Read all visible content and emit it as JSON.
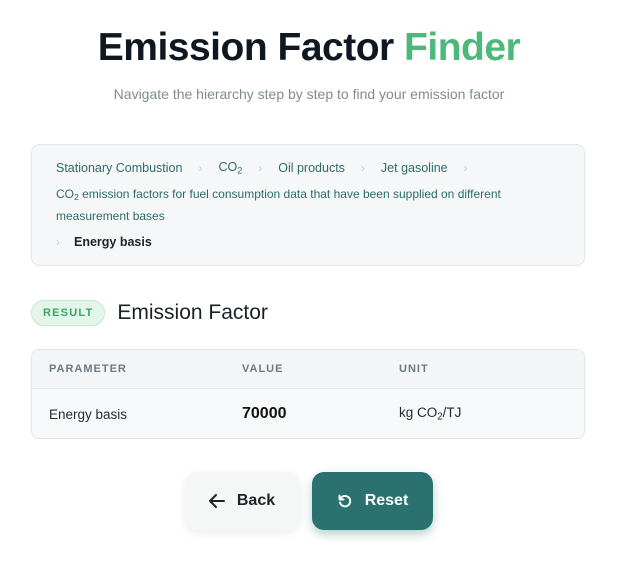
{
  "header": {
    "title_main": "Emission Factor",
    "title_accent": "Finder",
    "subtitle": "Navigate the hierarchy step by step to find your emission factor"
  },
  "breadcrumb": {
    "item1": "Stationary Combustion",
    "item2_prefix": "CO",
    "item2_sub": "2",
    "item3": "Oil products",
    "item4": "Jet gasoline",
    "item5_prefix": "CO",
    "item5_sub": "2",
    "item5_rest": " emission factors for fuel consumption data that have been supplied on different measurement bases",
    "current": "Energy basis"
  },
  "result": {
    "badge": "RESULT",
    "title": "Emission Factor"
  },
  "table": {
    "headers": [
      "PARAMETER",
      "VALUE",
      "UNIT"
    ],
    "row": {
      "parameter": "Energy basis",
      "value": "70000",
      "unit_prefix": "kg CO",
      "unit_sub": "2",
      "unit_suffix": "/TJ"
    }
  },
  "buttons": {
    "back": "Back",
    "reset": "Reset"
  },
  "colors": {
    "accent_green": "#4cb97a",
    "primary_teal": "#2a7170"
  }
}
